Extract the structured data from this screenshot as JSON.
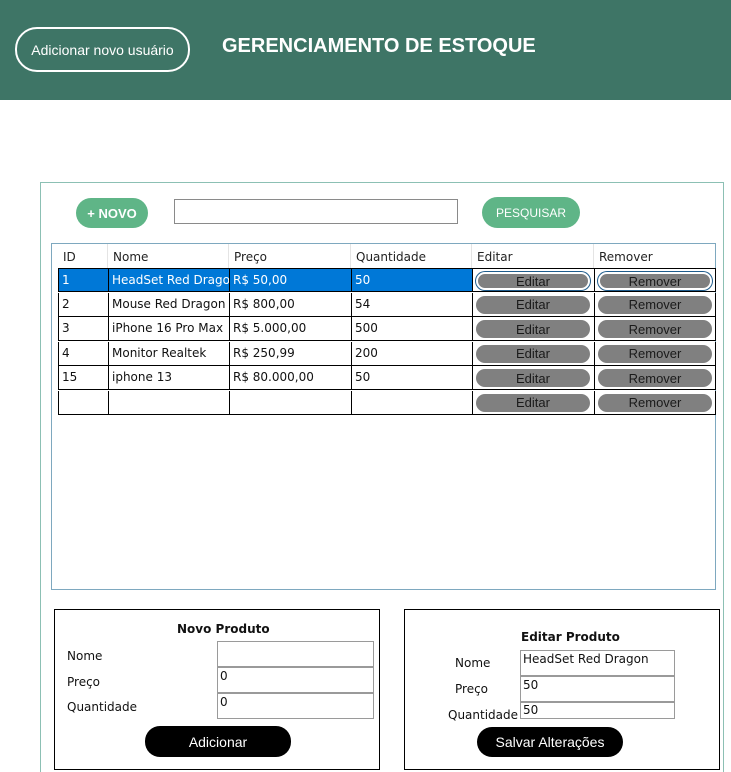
{
  "header": {
    "add_user_label": "Adicionar novo usuário",
    "title": "GERENCIAMENTO DE ESTOQUE",
    "background": "#3e7566"
  },
  "toolbar": {
    "new_label": "+ NOVO",
    "search_value": "",
    "search_label": "PESQUISAR",
    "accent": "#5fb587"
  },
  "grid": {
    "columns": [
      "ID",
      "Nome",
      "Preço",
      "Quantidade",
      "Editar",
      "Remover"
    ],
    "rows": [
      {
        "id": "1",
        "nome": "HeadSet Red Dragon",
        "preco": "R$ 50,00",
        "quantidade": "50",
        "editar": "Editar",
        "remover": "Remover",
        "selected": true
      },
      {
        "id": "2",
        "nome": "Mouse Red Dragon",
        "preco": "R$ 800,00",
        "quantidade": "54",
        "editar": "Editar",
        "remover": "Remover"
      },
      {
        "id": "3",
        "nome": "iPhone 16 Pro Max",
        "preco": "R$ 5.000,00",
        "quantidade": "500",
        "editar": "Editar",
        "remover": "Remover"
      },
      {
        "id": "4",
        "nome": "Monitor Realtek",
        "preco": "R$ 250,99",
        "quantidade": "200",
        "editar": "Editar",
        "remover": "Remover"
      },
      {
        "id": "15",
        "nome": "iphone 13",
        "preco": "R$ 80.000,00",
        "quantidade": "50",
        "editar": "Editar",
        "remover": "Remover"
      },
      {
        "id": "",
        "nome": "",
        "preco": "",
        "quantidade": "",
        "editar": "Editar",
        "remover": "Remover"
      }
    ],
    "selection_color": "#0078d7"
  },
  "new_product": {
    "title": "Novo Produto",
    "nome_label": "Nome",
    "preco_label": "Preço",
    "quantidade_label": "Quantidade",
    "nome_value": "",
    "preco_value": "0",
    "quantidade_value": "0",
    "submit_label": "Adicionar"
  },
  "edit_product": {
    "title": "Editar Produto",
    "nome_label": "Nome",
    "preco_label": "Preço",
    "quantidade_label": "Quantidade",
    "nome_value": "HeadSet Red Dragon",
    "preco_value": "50",
    "quantidade_value": "50",
    "submit_label": "Salvar Alterações"
  }
}
